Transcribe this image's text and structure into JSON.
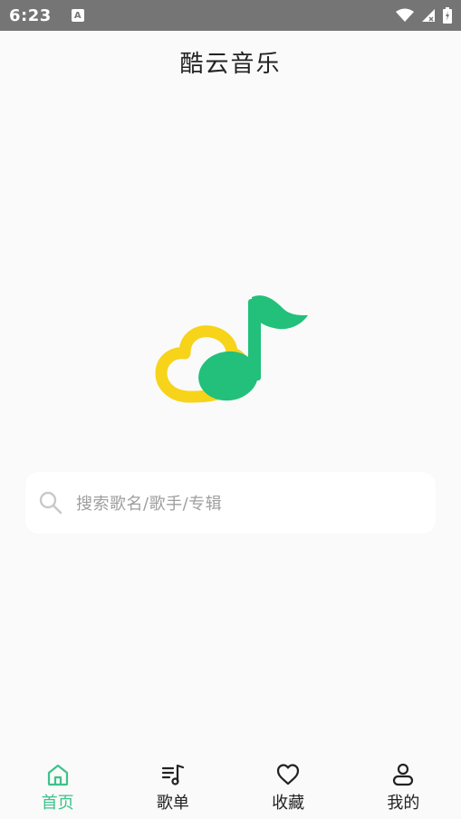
{
  "status_bar": {
    "time": "6:23",
    "notification_icon": "a-icon",
    "icons": [
      "wifi-icon",
      "signal-icon",
      "battery-icon"
    ]
  },
  "header": {
    "title": "酷云音乐"
  },
  "logo": {
    "name": "music-cloud-logo",
    "colors": {
      "cloud": "#f7d31a",
      "note": "#22c07a"
    }
  },
  "search": {
    "placeholder": "搜索歌名/歌手/专辑",
    "icon": "search-icon"
  },
  "bottom_nav": {
    "active_color": "#3cc28a",
    "items": [
      {
        "label": "首页",
        "icon": "home-icon",
        "active": true
      },
      {
        "label": "歌单",
        "icon": "playlist-icon",
        "active": false
      },
      {
        "label": "收藏",
        "icon": "heart-icon",
        "active": false
      },
      {
        "label": "我的",
        "icon": "user-icon",
        "active": false
      }
    ]
  }
}
